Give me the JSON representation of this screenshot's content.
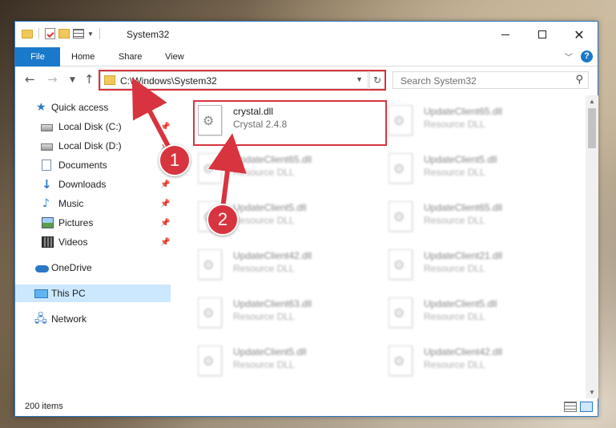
{
  "window": {
    "title": "System32"
  },
  "ribbon": {
    "tabs": [
      "File",
      "Home",
      "Share",
      "View"
    ],
    "help": "?"
  },
  "navbar": {
    "address": "C:\\Windows\\System32",
    "search_placeholder": "Search System32"
  },
  "sidebar": {
    "items": [
      {
        "label": "Quick access",
        "icon": "star-icon",
        "pinned": false
      },
      {
        "label": "Local Disk (C:)",
        "icon": "disk-icon",
        "pinned": true
      },
      {
        "label": "Local Disk (D:)",
        "icon": "disk-icon",
        "pinned": true
      },
      {
        "label": "Documents",
        "icon": "documents-icon",
        "pinned": true
      },
      {
        "label": "Downloads",
        "icon": "downloads-icon",
        "pinned": true
      },
      {
        "label": "Music",
        "icon": "music-icon",
        "pinned": true
      },
      {
        "label": "Pictures",
        "icon": "pictures-icon",
        "pinned": true
      },
      {
        "label": "Videos",
        "icon": "videos-icon",
        "pinned": true
      },
      {
        "label": "OneDrive",
        "icon": "onedrive-icon",
        "pinned": false
      },
      {
        "label": "This PC",
        "icon": "this-pc-icon",
        "pinned": false,
        "selected": true
      },
      {
        "label": "Network",
        "icon": "network-icon",
        "pinned": false
      }
    ]
  },
  "files": [
    {
      "name": "crystal.dll",
      "desc": "Crystal 2.4.8",
      "highlighted": true
    },
    {
      "name": "UpdateClient65.dll",
      "desc": "Resource DLL"
    },
    {
      "name": "UpdateClient65.dll",
      "desc": "Resource DLL"
    },
    {
      "name": "UpdateClient5.dll",
      "desc": "Resource DLL"
    },
    {
      "name": "UpdateClient5.dll",
      "desc": "Resource DLL"
    },
    {
      "name": "UpdateClient65.dll",
      "desc": "Resource DLL"
    },
    {
      "name": "UpdateClient42.dll",
      "desc": "Resource DLL"
    },
    {
      "name": "UpdateClient21.dll",
      "desc": "Resource DLL"
    },
    {
      "name": "UpdateClient63.dll",
      "desc": "Resource DLL"
    },
    {
      "name": "UpdateClient5.dll",
      "desc": "Resource DLL"
    },
    {
      "name": "UpdateClient5.dll",
      "desc": "Resource DLL"
    },
    {
      "name": "UpdateClient42.dll",
      "desc": "Resource DLL"
    }
  ],
  "status": {
    "item_count": "200 items"
  },
  "annotations": [
    "1",
    "2"
  ],
  "colors": {
    "accent": "#1979ca",
    "highlight": "#d8343f",
    "selection": "#cce8ff"
  }
}
